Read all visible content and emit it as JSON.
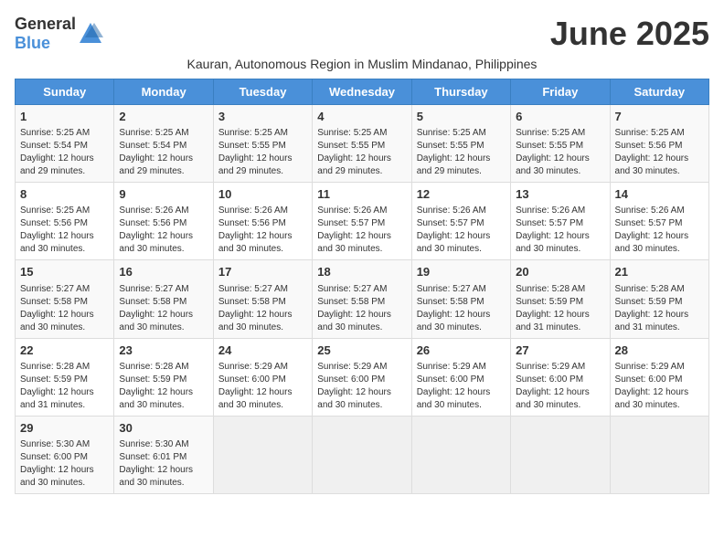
{
  "logo": {
    "general": "General",
    "blue": "Blue"
  },
  "title": "June 2025",
  "subtitle": "Kauran, Autonomous Region in Muslim Mindanao, Philippines",
  "days_of_week": [
    "Sunday",
    "Monday",
    "Tuesday",
    "Wednesday",
    "Thursday",
    "Friday",
    "Saturday"
  ],
  "weeks": [
    [
      {
        "day": "1",
        "info": "Sunrise: 5:25 AM\nSunset: 5:54 PM\nDaylight: 12 hours\nand 29 minutes."
      },
      {
        "day": "2",
        "info": "Sunrise: 5:25 AM\nSunset: 5:54 PM\nDaylight: 12 hours\nand 29 minutes."
      },
      {
        "day": "3",
        "info": "Sunrise: 5:25 AM\nSunset: 5:55 PM\nDaylight: 12 hours\nand 29 minutes."
      },
      {
        "day": "4",
        "info": "Sunrise: 5:25 AM\nSunset: 5:55 PM\nDaylight: 12 hours\nand 29 minutes."
      },
      {
        "day": "5",
        "info": "Sunrise: 5:25 AM\nSunset: 5:55 PM\nDaylight: 12 hours\nand 29 minutes."
      },
      {
        "day": "6",
        "info": "Sunrise: 5:25 AM\nSunset: 5:55 PM\nDaylight: 12 hours\nand 30 minutes."
      },
      {
        "day": "7",
        "info": "Sunrise: 5:25 AM\nSunset: 5:56 PM\nDaylight: 12 hours\nand 30 minutes."
      }
    ],
    [
      {
        "day": "8",
        "info": "Sunrise: 5:25 AM\nSunset: 5:56 PM\nDaylight: 12 hours\nand 30 minutes."
      },
      {
        "day": "9",
        "info": "Sunrise: 5:26 AM\nSunset: 5:56 PM\nDaylight: 12 hours\nand 30 minutes."
      },
      {
        "day": "10",
        "info": "Sunrise: 5:26 AM\nSunset: 5:56 PM\nDaylight: 12 hours\nand 30 minutes."
      },
      {
        "day": "11",
        "info": "Sunrise: 5:26 AM\nSunset: 5:57 PM\nDaylight: 12 hours\nand 30 minutes."
      },
      {
        "day": "12",
        "info": "Sunrise: 5:26 AM\nSunset: 5:57 PM\nDaylight: 12 hours\nand 30 minutes."
      },
      {
        "day": "13",
        "info": "Sunrise: 5:26 AM\nSunset: 5:57 PM\nDaylight: 12 hours\nand 30 minutes."
      },
      {
        "day": "14",
        "info": "Sunrise: 5:26 AM\nSunset: 5:57 PM\nDaylight: 12 hours\nand 30 minutes."
      }
    ],
    [
      {
        "day": "15",
        "info": "Sunrise: 5:27 AM\nSunset: 5:58 PM\nDaylight: 12 hours\nand 30 minutes."
      },
      {
        "day": "16",
        "info": "Sunrise: 5:27 AM\nSunset: 5:58 PM\nDaylight: 12 hours\nand 30 minutes."
      },
      {
        "day": "17",
        "info": "Sunrise: 5:27 AM\nSunset: 5:58 PM\nDaylight: 12 hours\nand 30 minutes."
      },
      {
        "day": "18",
        "info": "Sunrise: 5:27 AM\nSunset: 5:58 PM\nDaylight: 12 hours\nand 30 minutes."
      },
      {
        "day": "19",
        "info": "Sunrise: 5:27 AM\nSunset: 5:58 PM\nDaylight: 12 hours\nand 30 minutes."
      },
      {
        "day": "20",
        "info": "Sunrise: 5:28 AM\nSunset: 5:59 PM\nDaylight: 12 hours\nand 31 minutes."
      },
      {
        "day": "21",
        "info": "Sunrise: 5:28 AM\nSunset: 5:59 PM\nDaylight: 12 hours\nand 31 minutes."
      }
    ],
    [
      {
        "day": "22",
        "info": "Sunrise: 5:28 AM\nSunset: 5:59 PM\nDaylight: 12 hours\nand 31 minutes."
      },
      {
        "day": "23",
        "info": "Sunrise: 5:28 AM\nSunset: 5:59 PM\nDaylight: 12 hours\nand 30 minutes."
      },
      {
        "day": "24",
        "info": "Sunrise: 5:29 AM\nSunset: 6:00 PM\nDaylight: 12 hours\nand 30 minutes."
      },
      {
        "day": "25",
        "info": "Sunrise: 5:29 AM\nSunset: 6:00 PM\nDaylight: 12 hours\nand 30 minutes."
      },
      {
        "day": "26",
        "info": "Sunrise: 5:29 AM\nSunset: 6:00 PM\nDaylight: 12 hours\nand 30 minutes."
      },
      {
        "day": "27",
        "info": "Sunrise: 5:29 AM\nSunset: 6:00 PM\nDaylight: 12 hours\nand 30 minutes."
      },
      {
        "day": "28",
        "info": "Sunrise: 5:29 AM\nSunset: 6:00 PM\nDaylight: 12 hours\nand 30 minutes."
      }
    ],
    [
      {
        "day": "29",
        "info": "Sunrise: 5:30 AM\nSunset: 6:00 PM\nDaylight: 12 hours\nand 30 minutes."
      },
      {
        "day": "30",
        "info": "Sunrise: 5:30 AM\nSunset: 6:01 PM\nDaylight: 12 hours\nand 30 minutes."
      },
      {
        "day": "",
        "info": ""
      },
      {
        "day": "",
        "info": ""
      },
      {
        "day": "",
        "info": ""
      },
      {
        "day": "",
        "info": ""
      },
      {
        "day": "",
        "info": ""
      }
    ]
  ]
}
